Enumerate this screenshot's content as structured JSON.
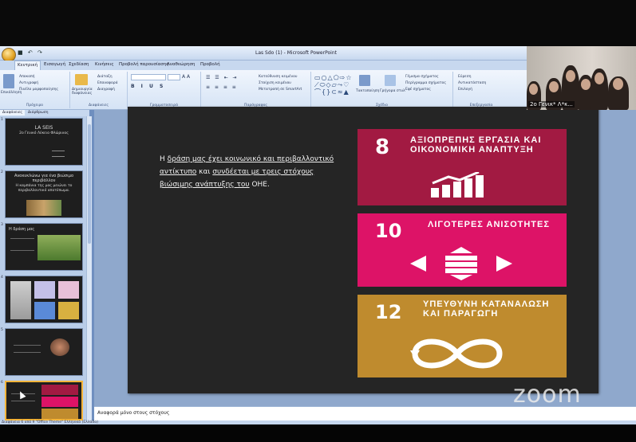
{
  "window": {
    "title": "Las Sdo (1) - Microsoft PowerPoint",
    "qat_icons": [
      "save-icon",
      "undo-icon",
      "redo-icon"
    ]
  },
  "ribbon": {
    "tabs": [
      "Κεντρική",
      "Εισαγωγή",
      "Σχεδίαση",
      "Κινήσεις",
      "Προβολή παρουσίασης",
      "Αναθεώρηση",
      "Προβολή"
    ],
    "groups": {
      "clipboard": {
        "label": "Πρόχειρο",
        "paste": "Επικόλληση",
        "cut": "Αποκοπή",
        "copy": "Αντιγραφή",
        "format_painter": "Πινέλο μορφοποίησης"
      },
      "slides": {
        "label": "Διαφάνειες",
        "new_slide": "Δημιουργία διαφάνειας",
        "layout": "Διάταξη",
        "reset": "Επαναφορά",
        "delete": "Διαγραφή"
      },
      "font": {
        "label": "Γραμματοσειρά"
      },
      "paragraph": {
        "label": "Παράγραφος",
        "text_direction": "Κατεύθυνση κειμένου",
        "align_text": "Στοίχιση κειμένου",
        "smartart": "Μετατροπή σε SmartArt"
      },
      "drawing": {
        "label": "Σχέδιο",
        "arrange": "Τακτοποίηση",
        "quick_styles": "Γρήγορα στυλ",
        "shape_fill": "Γέμισμα σχήματος",
        "shape_outline": "Περίγραμμα σχήματος",
        "shape_effects": "Εφέ σχήματος"
      },
      "editing": {
        "label": "Επεξεργασία",
        "find": "Εύρεση",
        "replace": "Αντικατάσταση",
        "select": "Επιλογή"
      }
    }
  },
  "sidepanel": {
    "tabs": [
      "Διαφάνειες",
      "Διάρθρωση"
    ],
    "thumbs": [
      {
        "num": "1",
        "title": "LA SEIS",
        "sub": "2ο Γενικό Λύκειο Φλώρινας"
      },
      {
        "num": "2",
        "title": "Ανακυκλώνω για ένα βιώσιμο περιβάλλον",
        "sub": "Η καμπάνια της μας μειώνει το περιβαλλοντικό αποτύπωμα."
      },
      {
        "num": "3",
        "title": "Η δράση μας",
        "sub": ""
      },
      {
        "num": "4",
        "title": "",
        "sub": ""
      },
      {
        "num": "5",
        "title": "",
        "sub": ""
      },
      {
        "num": "6",
        "title": "",
        "sub": ""
      }
    ]
  },
  "slide": {
    "text": {
      "p1": "Η ",
      "p2": "δράση μας έχει κοινωνικό και περιβαλλοντικό αντίκτυπο",
      "p3": " και  ",
      "p4": "συνδέεται με τρεις στόχους  βιώσιμης ανάπτυξης του",
      "p5": " ΟΗΕ."
    },
    "sdgs": [
      {
        "num": "8",
        "title": "ΑΞΙΟΠΡΕΠΗΣ ΕΡΓΑΣΙΑ ΚΑΙ ΟΙΚΟΝΟΜΙΚΗ ΑΝΑΠΤΥΞΗ",
        "color": "#a21a42",
        "icon": "growth-chart-icon"
      },
      {
        "num": "10",
        "title": "ΛΙΓΟΤΕΡΕΣ ΑΝΙΣΟΤΗΤΕΣ",
        "color": "#dd1367",
        "icon": "equality-icon"
      },
      {
        "num": "12",
        "title": "ΥΠΕΥΘΥΝΗ ΚΑΤΑΝΑΛΩΣΗ ΚΑΙ ΠΑΡΑΓΩΓΗ",
        "color": "#bf8b2e",
        "icon": "infinity-icon"
      }
    ]
  },
  "notes": {
    "text": "Αναφορά μόνο στους στόχους"
  },
  "statusbar": {
    "text": "Διαφάνεια 6 από 9   \"Office Theme\"   Ελληνικά (Ελλάδα)"
  },
  "webcam": {
    "label": "2ο Γενικ* Λ*κ..."
  },
  "zoom": {
    "watermark": "zoom"
  }
}
